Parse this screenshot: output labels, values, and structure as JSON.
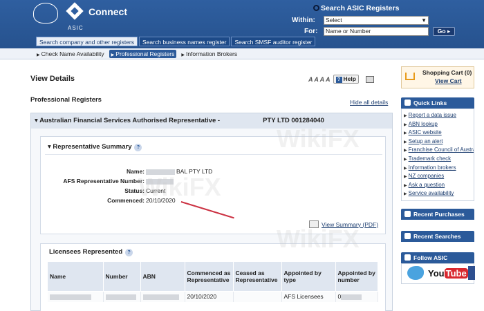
{
  "header": {
    "logo_text": "Connect",
    "logo_sub": "ASIC",
    "search_title": "Search ASIC Registers",
    "within_label": "Within:",
    "within_value": "Select",
    "for_label": "For:",
    "for_placeholder": "Name or Number",
    "go_label": "Go",
    "tabs": [
      {
        "label": "Search company and other registers",
        "active": true
      },
      {
        "label": "Search business names register",
        "active": false
      },
      {
        "label": "Search SMSF auditor register",
        "active": false
      }
    ]
  },
  "subnav": {
    "items": [
      {
        "label": "Check Name Availability",
        "active": false
      },
      {
        "label": "Professional Registers",
        "active": true
      },
      {
        "label": "Information Brokers",
        "active": false
      }
    ]
  },
  "main": {
    "page_title": "View Details",
    "help_label": "Help",
    "font_icon_text": "A A A A",
    "section_title": "Professional Registers",
    "hide_all": "Hide all details",
    "afs_title_prefix": "Australian Financial Services Authorised Representative -",
    "afs_title_suffix": "PTY LTD 001284040",
    "rep_summary": {
      "title": "Representative Summary",
      "fields": [
        {
          "label": "Name:",
          "value": "BAL PTY LTD"
        },
        {
          "label": "AFS Representative Number:",
          "value": ""
        },
        {
          "label": "Status:",
          "value": "Current"
        },
        {
          "label": "Commenced:",
          "value": "20/10/2020"
        }
      ],
      "pdf_link": "View Summary (PDF)"
    },
    "licensees": {
      "title": "Licensees Represented",
      "columns": [
        "Name",
        "Number",
        "ABN",
        "Commenced as Representative",
        "Ceased as Representative",
        "Appointed by type",
        "Appointed by number"
      ],
      "rows": [
        {
          "commenced": "20/10/2020",
          "ceased": "",
          "type": "AFS Licensees",
          "number": "0"
        }
      ]
    }
  },
  "sidebar": {
    "cart_title": "Shopping Cart (0)",
    "cart_link": "View Cart",
    "quick_links_title": "Quick Links",
    "quick_links": [
      "Report a data issue",
      "ABN lookup",
      "ASIC website",
      "Setup an alert",
      "Franchise Council of Australia",
      "Trademark check",
      "Information brokers",
      "NZ companies",
      "Ask a question",
      "Service availability"
    ],
    "recent_purchases": "Recent Purchases",
    "recent_searches": "Recent Searches",
    "follow": "Follow ASIC",
    "youtube_you": "You",
    "youtube_tube": "Tube"
  },
  "watermark": "WikiFX"
}
